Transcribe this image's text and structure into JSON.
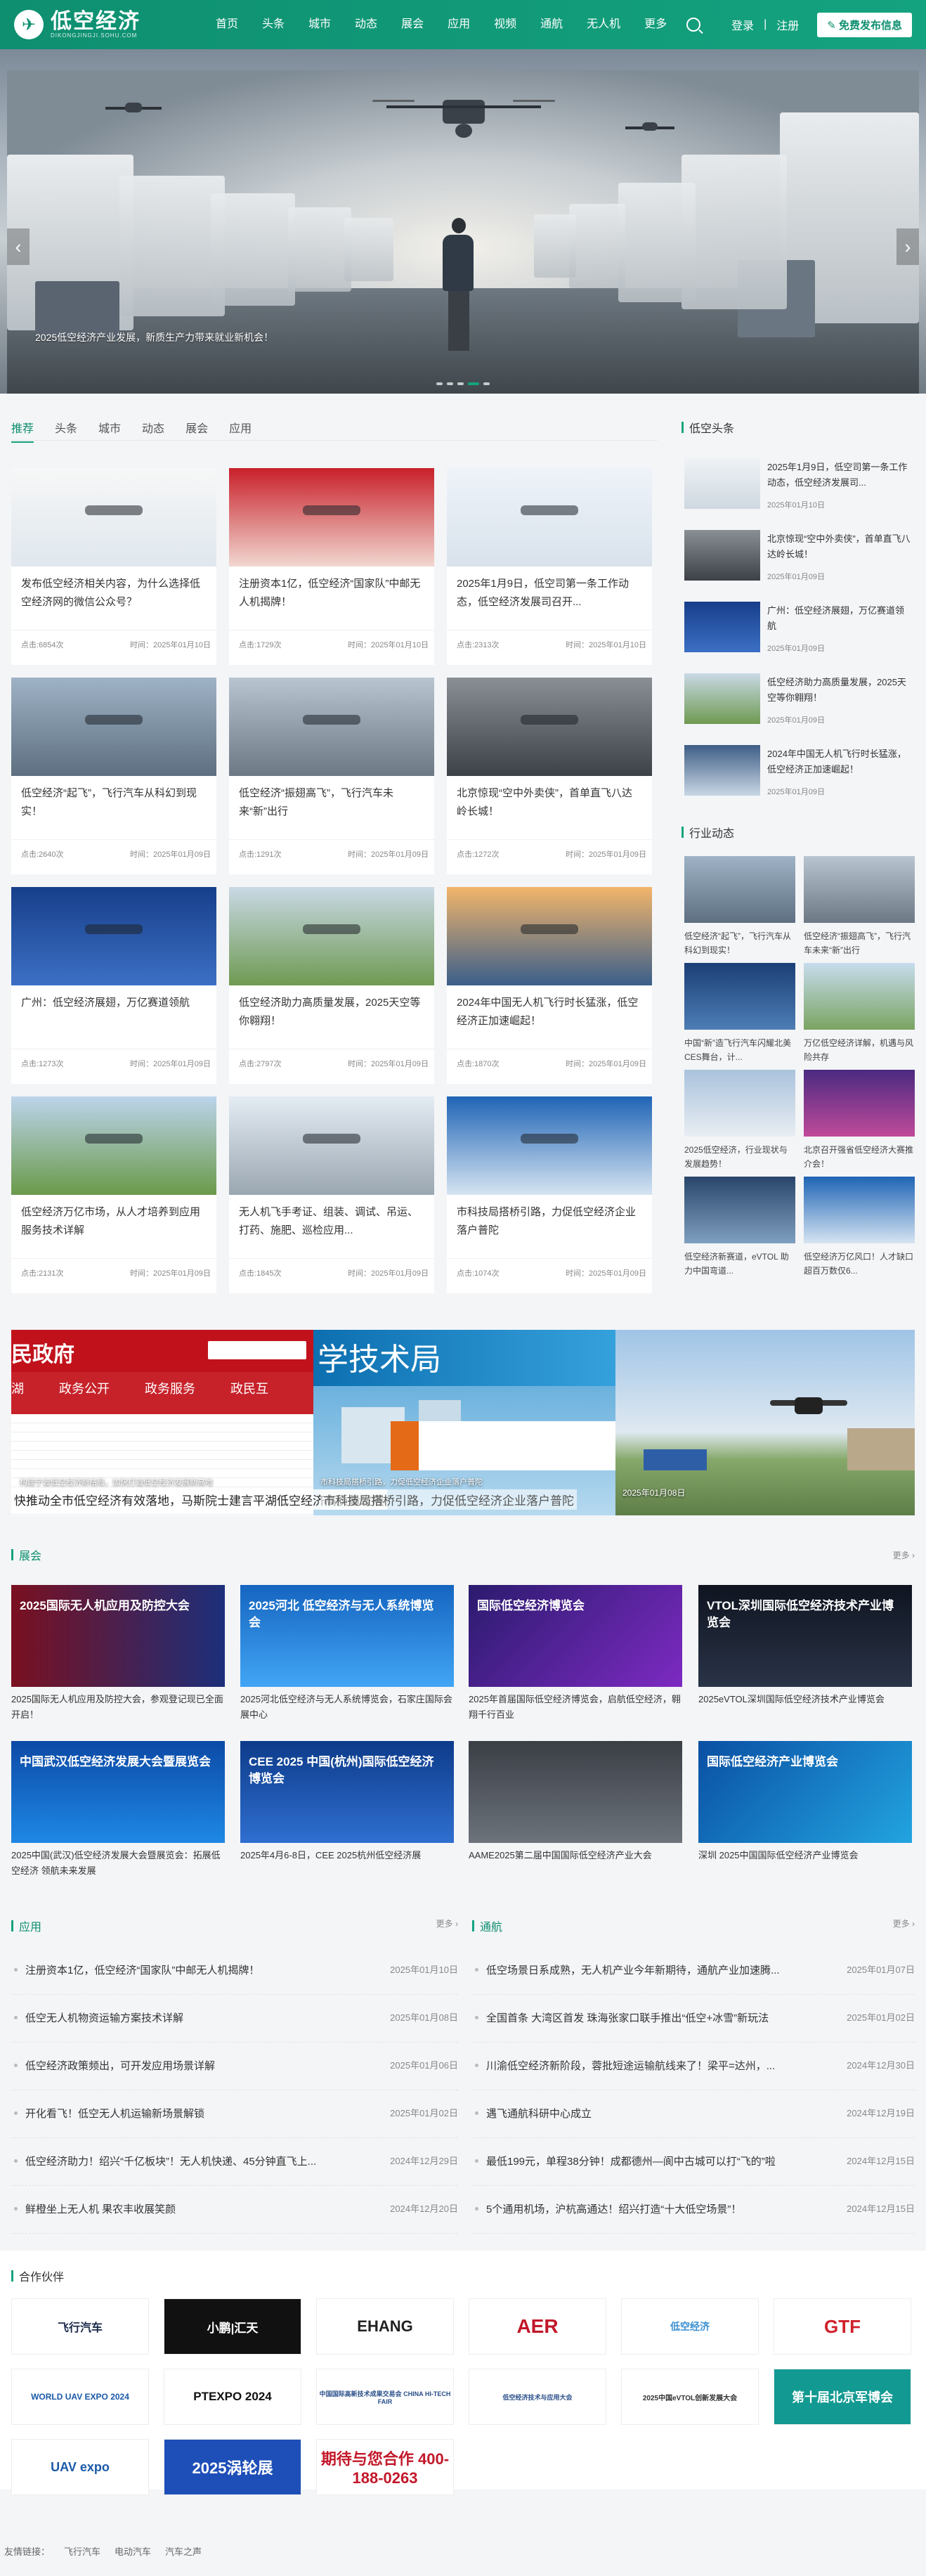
{
  "header": {
    "logo_text": "低空经济",
    "logo_sub": "DIKONGJINGJI.SOHU.COM",
    "nav": [
      "首页",
      "头条",
      "城市",
      "动态",
      "展会",
      "应用",
      "视频",
      "通航",
      "无人机",
      "更多"
    ],
    "login": "登录",
    "register": "注册",
    "publish": "免费发布信息"
  },
  "hero": {
    "caption": "2025低空经济产业发展，新质生产力带来就业新机会！"
  },
  "tabs": [
    "推荐",
    "头条",
    "城市",
    "动态",
    "展会",
    "应用"
  ],
  "cards": [
    {
      "title": "发布低空经济相关内容，为什么选择低空经济网的微信公众号？",
      "views": "点击:6854次",
      "time": "时间：2025年01月10日"
    },
    {
      "title": "注册资本1亿，低空经济“国家队”中邮无人机揭牌！",
      "views": "点击:1729次",
      "time": "时间：2025年01月10日"
    },
    {
      "title": "2025年1月9日，低空司第一条工作动态，低空经济发展司召开...",
      "views": "点击:2313次",
      "time": "时间：2025年01月10日"
    },
    {
      "title": "低空经济“起飞”，飞行汽车从科幻到现实！",
      "views": "点击:2640次",
      "time": "时间：2025年01月09日"
    },
    {
      "title": "低空经济“振翅高飞”，飞行汽车未来“新”出行",
      "views": "点击:1291次",
      "time": "时间：2025年01月09日"
    },
    {
      "title": "北京惊现“空中外卖侠”，首单直飞八达岭长城！",
      "views": "点击:1272次",
      "time": "时间：2025年01月09日"
    },
    {
      "title": "广州：低空经济展翅，万亿赛道领航",
      "views": "点击:1273次",
      "time": "时间：2025年01月09日"
    },
    {
      "title": "低空经济助力高质量发展，2025天空等你翱翔！",
      "views": "点击:2797次",
      "time": "时间：2025年01月09日"
    },
    {
      "title": "2024年中国无人机飞行时长猛涨，低空经济正加速崛起！",
      "views": "点击:1870次",
      "time": "时间：2025年01月09日"
    },
    {
      "title": "低空经济万亿市场，从人才培养到应用服务技术详解",
      "views": "点击:2131次",
      "time": "时间：2025年01月09日"
    },
    {
      "title": "无人机飞手考证、组装、调试、吊运、打药、施肥、巡检应用...",
      "views": "点击:1845次",
      "time": "时间：2025年01月09日"
    },
    {
      "title": "市科技局搭桥引路，力促低空经济企业落户普陀",
      "views": "点击:1074次",
      "time": "时间：2025年01月09日"
    }
  ],
  "sidebar": {
    "headline_title": "低空头条",
    "headlines": [
      {
        "title": "2025年1月9日，低空司第一条工作动态，低空经济发展司...",
        "date": "2025年01月10日"
      },
      {
        "title": "北京惊现“空中外卖侠”，首单直飞八达岭长城！",
        "date": "2025年01月09日"
      },
      {
        "title": "广州：低空经济展翅，万亿赛道领航",
        "date": "2025年01月09日"
      },
      {
        "title": "低空经济助力高质量发展，2025天空等你翱翔！",
        "date": "2025年01月09日"
      },
      {
        "title": "2024年中国无人机飞行时长猛涨，低空经济正加速崛起！",
        "date": "2025年01月09日"
      }
    ],
    "news_title": "行业动态",
    "news": [
      "低空经济“起飞”，飞行汽车从科幻到现实！",
      "低空经济“振翅高飞”，飞行汽车未来“新”出行",
      "中国“新”造飞行汽车闪耀北美CES舞台，计...",
      "万亿低空经济详解，机遇与风险共存",
      "2025低空经济，行业现状与发展趋势！",
      "北京召开强省低空经济大赛推介会！",
      "低空经济新赛道，eVTOL 助力中国弯道...",
      "低空经济万亿风口！人才缺口超百万数仅6..."
    ]
  },
  "strip": {
    "captions": [
      "构建宁波低空经济新格局，加快打造低空经济发展新高地",
      "市科技局搭桥引路，力促低空经济企业落户普陀",
      "2025年01月08日"
    ],
    "overlay": "快推动全市低空经济有效落地，马斯院士建言平湖低空经济高质量发展",
    "overlay2": "市科技局搭桥引路，力促低空经济企业落户普陀"
  },
  "expo": {
    "title": "展会",
    "more": "更多",
    "items": [
      {
        "title": "2025国际无人机应用及防控大会，参观登记现已全面开启！",
        "label": "2025国际无人机应用及防控大会"
      },
      {
        "title": "2025河北低空经济与无人系统博览会，石家庄国际会展中心",
        "label": "2025河北 低空经济与无人系统博览会"
      },
      {
        "title": "2025年首届国际低空经济博览会，启航低空经济，翱翔千行百业",
        "label": "国际低空经济博览会"
      },
      {
        "title": "2025eVTOL深圳国际低空经济技术产业博览会",
        "label": "VTOL深圳国际低空经济技术产业博览会"
      },
      {
        "title": "2025中国(武汉)低空经济发展大会暨展览会：拓展低空经济 领航未来发展",
        "label": "中国武汉低空经济发展大会暨展览会"
      },
      {
        "title": "2025年4月6-8日，CEE 2025杭州低空经济展",
        "label": "CEE 2025 中国(杭州)国际低空经济博览会"
      },
      {
        "title": "AAME2025第二届中国国际低空经济产业大会",
        "label": ""
      },
      {
        "title": "深圳 2025中国国际低空经济产业博览会",
        "label": "国际低空经济产业博览会"
      }
    ]
  },
  "apps": {
    "title": "应用",
    "more": "更多",
    "items": [
      {
        "text": "注册资本1亿，低空经济“国家队”中邮无人机揭牌！",
        "date": "2025年01月10日"
      },
      {
        "text": "低空无人机物资运输方案技术详解",
        "date": "2025年01月08日"
      },
      {
        "text": "低空经济政策频出，可开发应用场景详解",
        "date": "2025年01月06日"
      },
      {
        "text": "开化看飞！低空无人机运输新场景解锁",
        "date": "2025年01月02日"
      },
      {
        "text": "低空经济助力！绍兴“千亿板块”！无人机快递、45分钟直飞上...",
        "date": "2024年12月29日"
      },
      {
        "text": "鲜橙坐上无人机 果农丰收展笑颜",
        "date": "2024年12月20日"
      }
    ]
  },
  "aviation": {
    "title": "通航",
    "more": "更多",
    "items": [
      {
        "text": "低空场景日系成熟，无人机产业今年新期待，通航产业加速腾...",
        "date": "2025年01月07日"
      },
      {
        "text": "全国首条 大湾区首发 珠海张家口联手推出“低空+冰雪”新玩法",
        "date": "2025年01月02日"
      },
      {
        "text": "川渝低空经济新阶段，蓉批短途运输航线来了！梁平=达州，...",
        "date": "2024年12月30日"
      },
      {
        "text": "遇飞通航科研中心成立",
        "date": "2024年12月19日"
      },
      {
        "text": "最低199元，单程38分钟！成都德州—阆中古城可以打“飞的”啦",
        "date": "2024年12月15日"
      },
      {
        "text": "5个通用机场，沪杭高通达！绍兴打造“十大低空场景”！",
        "date": "2024年12月15日"
      }
    ]
  },
  "partners": {
    "title": "合作伙伴",
    "logos": [
      "飞行汽车",
      "小鹏|汇天",
      "EHANG",
      "AER",
      "低空经济",
      "GTF",
      "WORLD UAV EXPO 2024",
      "PTEXPO 2024",
      "中国国际高新技术成果交易会 CHINA HI-TECH FAIR",
      "低空经济技术与应用大会",
      "2025中国eVTOL创新发展大会",
      "第十届北京军博会",
      "UAV expo",
      "2025涡轮展",
      "期待与您合作 400-188-0263"
    ]
  },
  "footer": {
    "label": "友情链接：",
    "links": [
      "飞行汽车",
      "电动汽车",
      "汽车之声"
    ]
  },
  "colors": {
    "brand": "#14a37f",
    "brand_dark": "#0e8f70"
  }
}
